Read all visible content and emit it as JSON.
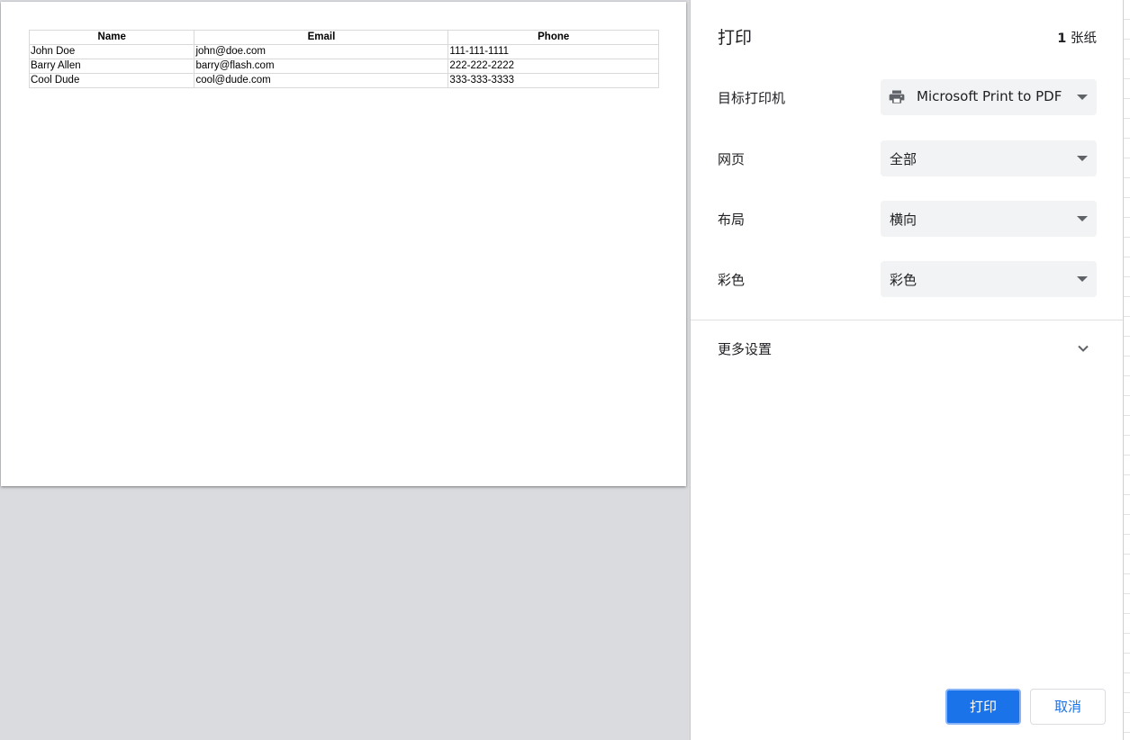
{
  "preview": {
    "table": {
      "headers": [
        "Name",
        "Email",
        "Phone"
      ],
      "rows": [
        [
          "John Doe",
          "john@doe.com",
          "111-111-1111"
        ],
        [
          "Barry Allen",
          "barry@flash.com",
          "222-222-2222"
        ],
        [
          "Cool Dude",
          "cool@dude.com",
          "333-333-3333"
        ]
      ]
    }
  },
  "panel": {
    "title": "打印",
    "sheet_count_number": "1",
    "sheet_count_unit": "张纸",
    "destination": {
      "label": "目标打印机",
      "value": "Microsoft Print to PDF",
      "icon": "printer-icon"
    },
    "pages": {
      "label": "网页",
      "value": "全部"
    },
    "layout": {
      "label": "布局",
      "value": "横向"
    },
    "color": {
      "label": "彩色",
      "value": "彩色"
    },
    "more_settings": {
      "label": "更多设置",
      "icon": "chevron-down-icon"
    },
    "buttons": {
      "print": "打印",
      "cancel": "取消"
    }
  },
  "colors": {
    "accent": "#1a73e8",
    "select_bg": "#f1f3f4",
    "preview_bg": "#dadbdf"
  }
}
